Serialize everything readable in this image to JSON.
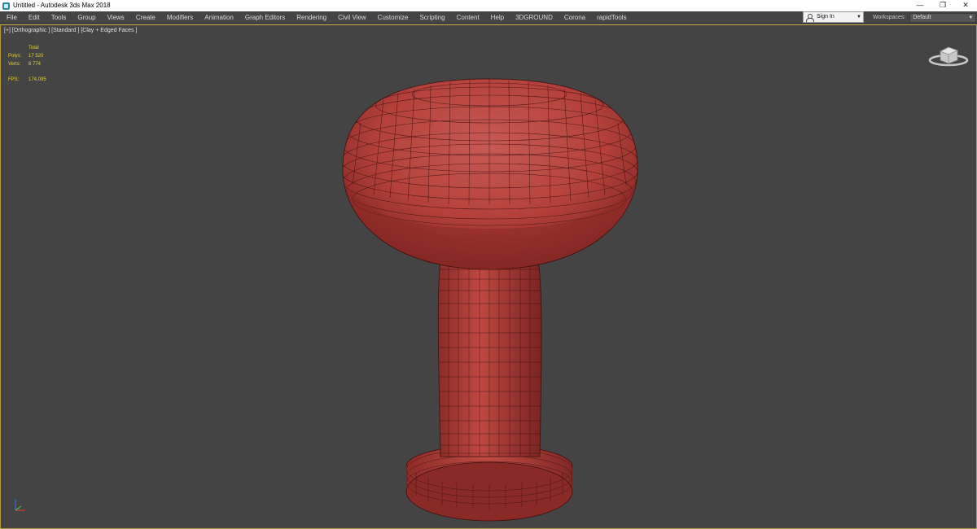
{
  "window": {
    "title": "Untitled - Autodesk 3ds Max 2018",
    "controls": {
      "minimize": "—",
      "restore": "❐",
      "close": "✕"
    }
  },
  "menu": {
    "items": [
      "File",
      "Edit",
      "Tools",
      "Group",
      "Views",
      "Create",
      "Modifiers",
      "Animation",
      "Graph Editors",
      "Rendering",
      "Civil View",
      "Customize",
      "Scripting",
      "Content",
      "Help",
      "3DGROUND",
      "Corona",
      "rapidTools"
    ]
  },
  "account": {
    "signin_label": "Sign In",
    "signin_icon": "user-icon"
  },
  "workspaces": {
    "label": "Workspaces:",
    "value": "Default"
  },
  "viewport": {
    "label": "[+] [Orthographic ] [Standard ] [Clay + Edged Faces ]",
    "border_color": "#c9aa3c",
    "background": "#444444",
    "model_color": "#b3403b",
    "stats": {
      "total_label": "Total",
      "polys_label": "Polys:",
      "polys_value": "17 520",
      "verts_label": "Verts:",
      "verts_value": "8 774",
      "fps_label": "FPS:",
      "fps_value": "174,095"
    }
  }
}
